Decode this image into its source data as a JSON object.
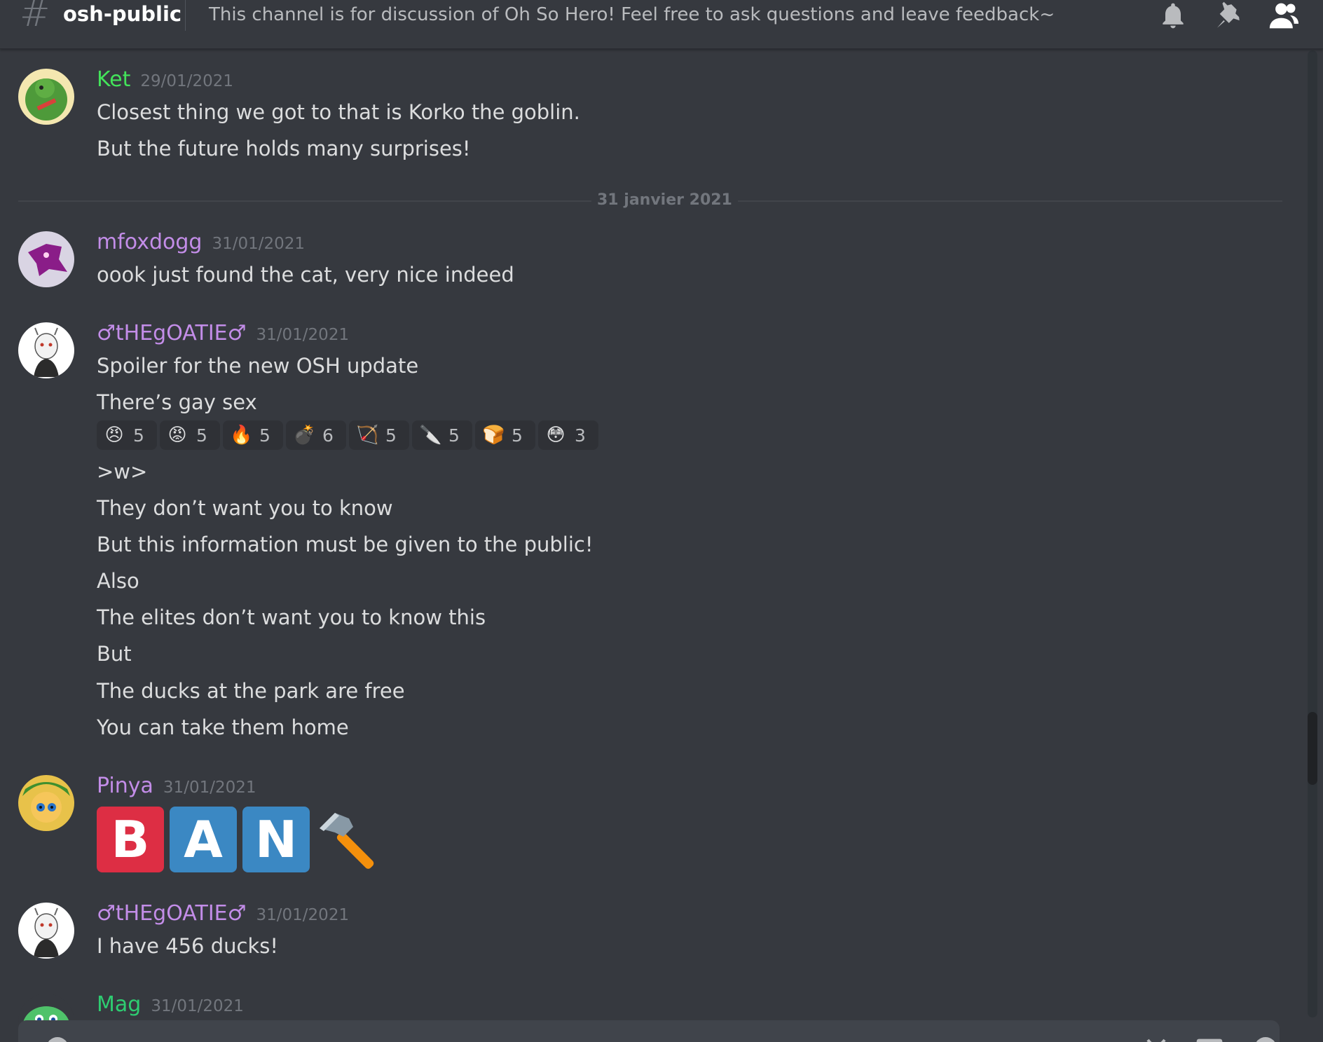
{
  "header": {
    "channel": "osh-public",
    "topic": "This channel is for discussion of Oh So Hero! Feel free to ask questions and leave feedback~",
    "icons": [
      "bell-icon",
      "pin-icon",
      "members-icon"
    ]
  },
  "date_separator": "31 janvier 2021",
  "messages": [
    {
      "username": "Ket",
      "color": "#43e35a",
      "timestamp": "29/01/2021",
      "lines": [
        "Closest thing we got to that is Korko the goblin.",
        "But the future holds many surprises!"
      ]
    },
    {
      "username": "mfoxdogg",
      "color": "#c38de8",
      "timestamp": "31/01/2021",
      "lines": [
        "oook just found the cat, very nice indeed"
      ]
    },
    {
      "username": "♂tHEgOATIE♂",
      "color": "#c38de8",
      "timestamp": "31/01/2021",
      "lines": [
        "Spoiler for the new OSH update",
        "There’s gay sex"
      ],
      "reactions": [
        {
          "emoji": "😠",
          "count": "5"
        },
        {
          "emoji": "😡",
          "count": "5"
        },
        {
          "emoji": "🔥",
          "count": "5"
        },
        {
          "emoji": "💣",
          "count": "6"
        },
        {
          "emoji": "🏹",
          "count": "5"
        },
        {
          "emoji": "🔪",
          "count": "5"
        },
        {
          "emoji": "🍞",
          "count": "5"
        },
        {
          "emoji": "😳",
          "count": "3"
        }
      ],
      "more_lines": [
        ">w>",
        "They don’t want you to know",
        "But this information must be given to the public!",
        "Also",
        "The elites don’t want you to know this",
        "But",
        "The ducks at the park are free",
        "You can take them home"
      ]
    },
    {
      "username": "Pinya",
      "color": "#c38de8",
      "timestamp": "31/01/2021",
      "tiles": [
        "B",
        "A",
        "N"
      ],
      "tile_colors": [
        "#dd2e44",
        "#3b88c3",
        "#3b88c3"
      ]
    },
    {
      "username": "♂tHEgOATIE♂",
      "color": "#c38de8",
      "timestamp": "31/01/2021",
      "lines": [
        "I have 456 ducks!"
      ]
    },
    {
      "username": "Mag",
      "color": "#2ecc71",
      "timestamp": "31/01/2021"
    }
  ]
}
